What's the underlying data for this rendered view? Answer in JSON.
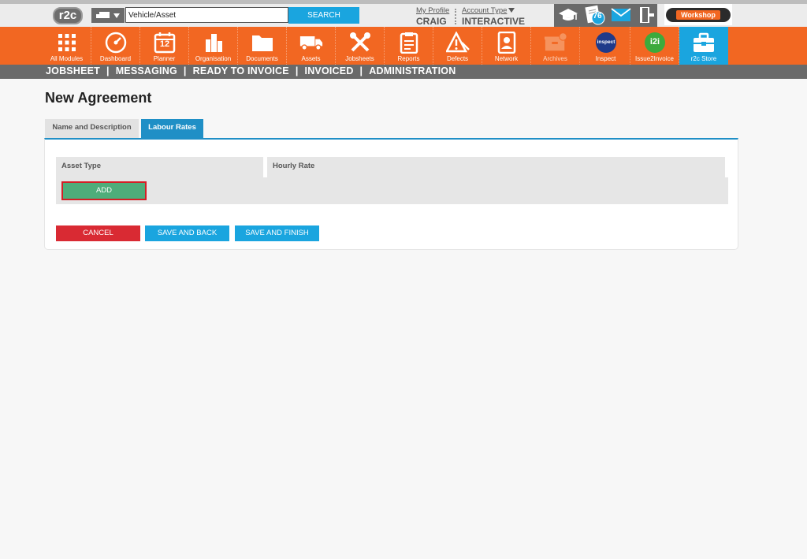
{
  "header": {
    "logo_text": "r2c",
    "search": {
      "value": "Vehicle/Asset",
      "button_label": "SEARCH"
    },
    "profile": {
      "link_label": "My Profile",
      "user_name": "CRAIG"
    },
    "account": {
      "link_label": "Account Type",
      "value": "INTERACTIVE"
    },
    "mail_badge_count": "76",
    "workshop_label": "Workshop"
  },
  "nav": {
    "modules": [
      {
        "label": "All Modules",
        "icon": "grid-icon"
      },
      {
        "label": "Dashboard",
        "icon": "gauge-icon"
      },
      {
        "label": "Planner",
        "icon": "calendar-icon",
        "badge": "12"
      },
      {
        "label": "Organisation",
        "icon": "buildings-icon"
      },
      {
        "label": "Documents",
        "icon": "folder-icon"
      },
      {
        "label": "Assets",
        "icon": "truck-icon"
      },
      {
        "label": "Jobsheets",
        "icon": "tools-icon"
      },
      {
        "label": "Reports",
        "icon": "clipboard-icon"
      },
      {
        "label": "Defects",
        "icon": "warning-icon"
      },
      {
        "label": "Network",
        "icon": "address-book-icon"
      },
      {
        "label": "Archives",
        "icon": "archive-icon"
      },
      {
        "label": "Inspect",
        "icon": "inspect-icon",
        "badge": "inspect"
      },
      {
        "label": "Issue2Invoice",
        "icon": "i2i-icon",
        "badge": "i2i"
      },
      {
        "label": "r2c Store",
        "icon": "briefcase-icon"
      }
    ]
  },
  "subnav": {
    "items": [
      "JOBSHEET",
      "MESSAGING",
      "READY TO INVOICE",
      "INVOICED",
      "ADMINISTRATION"
    ],
    "separator": "|"
  },
  "page": {
    "title": "New Agreement",
    "tabs": [
      {
        "label": "Name and Description"
      },
      {
        "label": "Labour Rates"
      }
    ],
    "table": {
      "columns": [
        "Asset Type",
        "Hourly Rate"
      ],
      "add_label": "ADD"
    },
    "buttons": {
      "cancel": "CANCEL",
      "save_back": "SAVE AND BACK",
      "save_finish": "SAVE AND FINISH"
    }
  },
  "colors": {
    "brand_orange": "#f26722",
    "accent_blue": "#1aa5df",
    "danger_red": "#d92a33",
    "success_green": "#4ead7a"
  }
}
